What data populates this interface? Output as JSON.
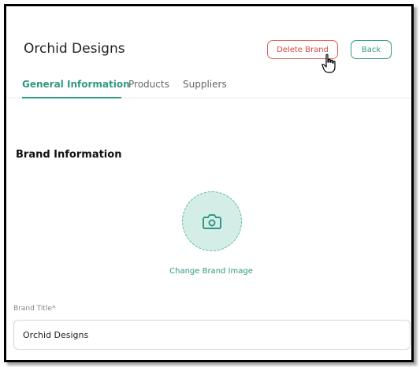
{
  "header": {
    "brand_name": "Orchid Designs",
    "delete_label": "Delete Brand",
    "back_label": "Back"
  },
  "tabs": [
    {
      "label": "General Information",
      "active": true
    },
    {
      "label": "Products",
      "active": false
    },
    {
      "label": "Suppliers",
      "active": false
    }
  ],
  "section": {
    "title": "Brand Information",
    "change_image_label": "Change Brand Image"
  },
  "form": {
    "brand_title_label": "Brand Title*",
    "brand_title_value": "Orchid Designs"
  },
  "icons": {
    "camera": "camera-icon",
    "cursor": "hand-pointer-icon"
  },
  "colors": {
    "accent": "#2f9a82",
    "danger": "#d9463f",
    "avatar_bg": "#d4ede7"
  }
}
